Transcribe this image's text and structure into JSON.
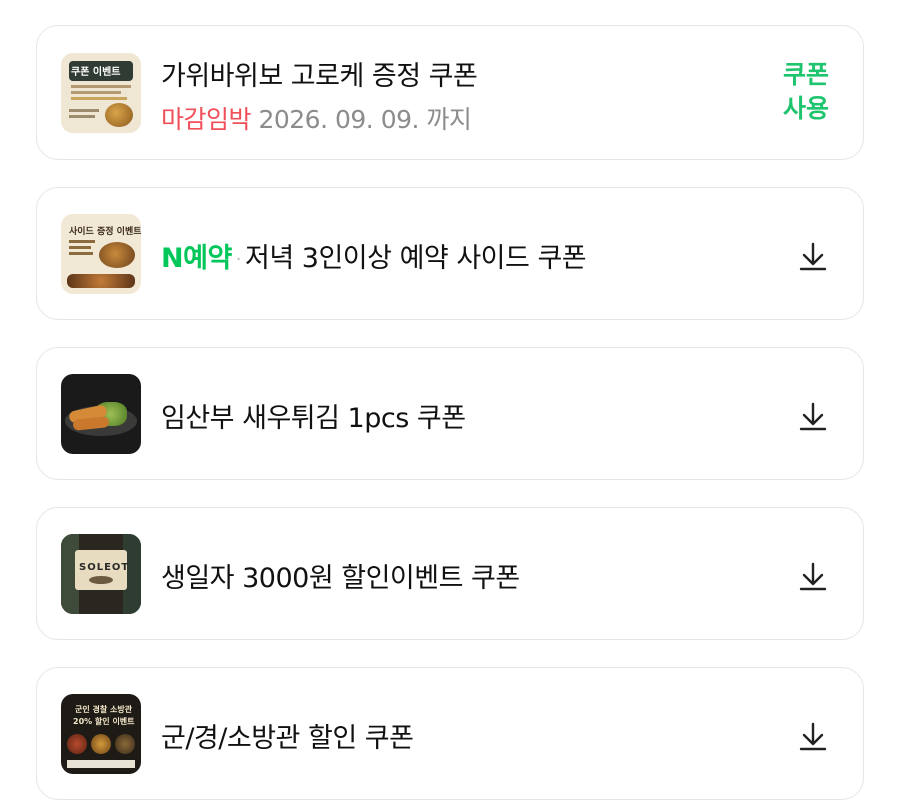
{
  "coupons": [
    {
      "title": "가위바위보 고로케 증정 쿠폰",
      "deadline_label": "마감임박",
      "expiry": "2026. 09. 09. 까지",
      "action_line1": "쿠폰",
      "action_line2": "사용",
      "thumb_text": "쿠폰 이벤트",
      "thumb_icon": "croquette-image"
    },
    {
      "brand_n": "N",
      "brand_label": "예약",
      "separator": "·",
      "title": "저녁 3인이상 예약 사이드 쿠폰",
      "thumb_text": "사이드 증정 이벤트",
      "action_icon": "download-icon"
    },
    {
      "title": "임산부 새우튀김 1pcs 쿠폰",
      "thumb_icon": "shrimp-tempura-photo",
      "action_icon": "download-icon"
    },
    {
      "title": "생일자 3000원 할인이벤트 쿠폰",
      "thumb_text": "SOLEOT",
      "action_icon": "download-icon"
    },
    {
      "title": "군/경/소방관 할인 쿠폰",
      "thumb_text_1": "군인 경찰 소방관",
      "thumb_text_2": "20% 할인 이벤트",
      "action_icon": "download-icon"
    }
  ],
  "colors": {
    "accent_green": "#1ec46e",
    "naver_green": "#03c75a",
    "deadline_red": "#f0505a",
    "muted_gray": "#8c8c8c"
  }
}
